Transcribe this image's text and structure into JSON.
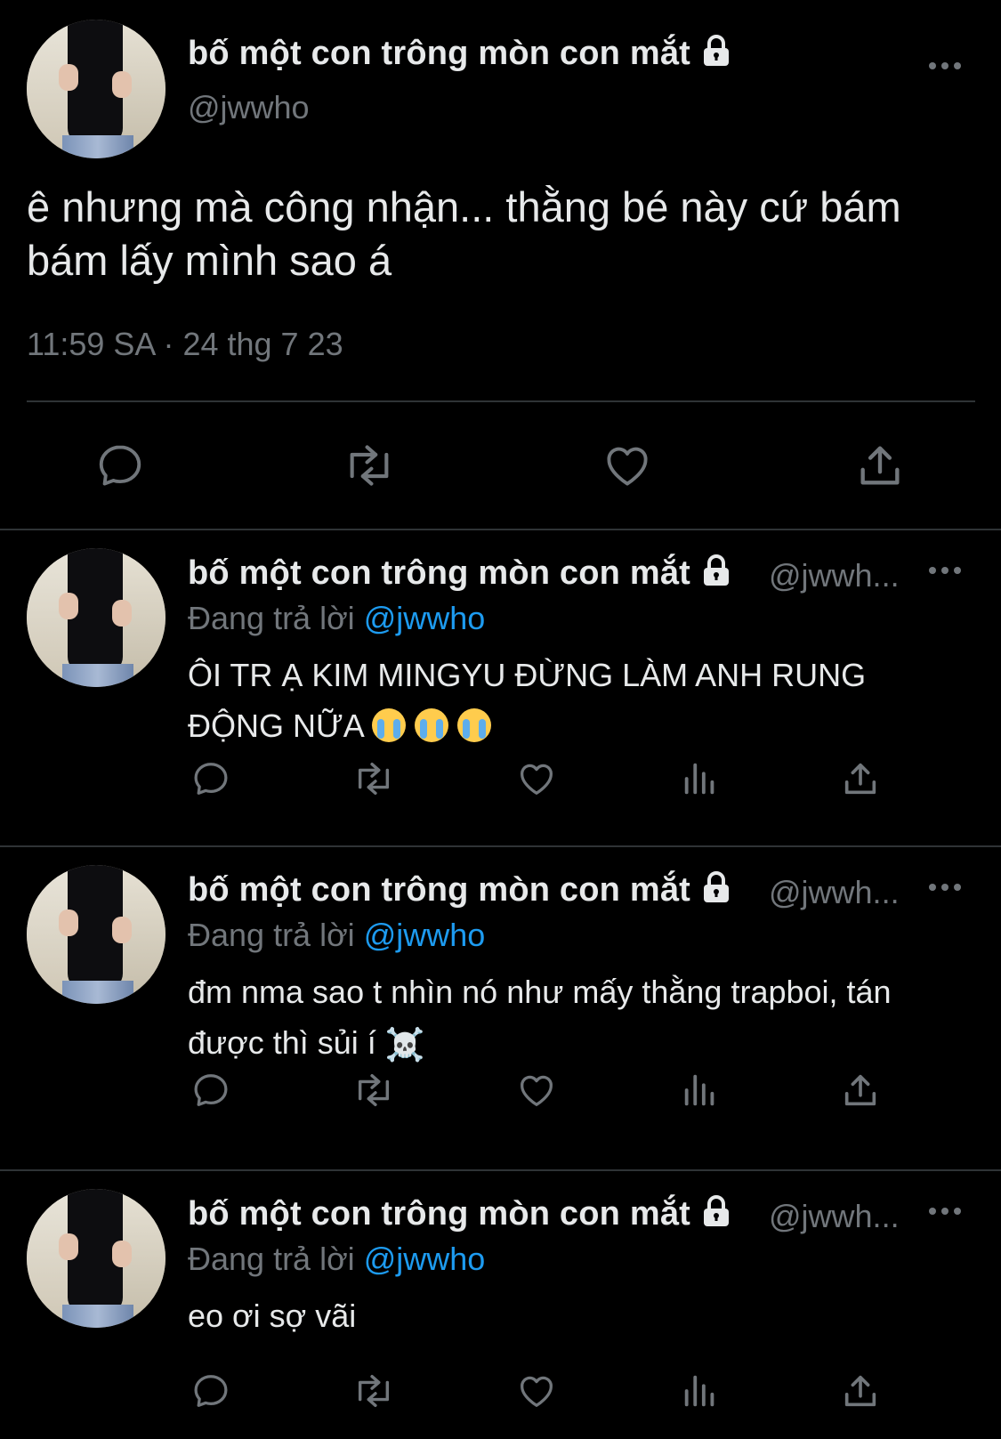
{
  "main_tweet": {
    "display_name": "bố một con trông mòn con mắt",
    "handle": "@jwwho",
    "text": "ê nhưng mà công nhận... thằng bé này cứ bám bám lấy mình sao á",
    "timestamp": "11:59 SA · 24 thg 7 23"
  },
  "replies": [
    {
      "display_name": "bố một con trông mòn con mắt",
      "handle": "@jwwh...",
      "replying_label": "Đang trả lời",
      "replying_to": "@jwwho",
      "text": "ÔI TR Ạ KIM MINGYU ĐỪNG LÀM ANH RUNG ĐỘNG NỮA",
      "emoji": "😭 😭 😭"
    },
    {
      "display_name": "bố một con trông mòn con mắt",
      "handle": "@jwwh...",
      "replying_label": "Đang trả lời",
      "replying_to": "@jwwho",
      "text": "đm nma sao t nhìn nó như mấy thằng trapboi, tán được thì sủi í",
      "emoji": "☠️"
    },
    {
      "display_name": "bố một con trông mòn con mắt",
      "handle": "@jwwh...",
      "replying_label": "Đang trả lời",
      "replying_to": "@jwwho",
      "text": "eo ơi sợ vãi",
      "emoji": ""
    }
  ],
  "icons": {
    "reply": "reply-icon",
    "retweet": "retweet-icon",
    "like": "heart-icon",
    "views": "views-icon",
    "share": "share-icon",
    "lock": "lock-icon",
    "more": "more-icon"
  },
  "colors": {
    "background": "#000000",
    "text": "#e7e9ea",
    "muted": "#71767b",
    "link": "#1d9bf0",
    "divider": "#2f3336"
  }
}
